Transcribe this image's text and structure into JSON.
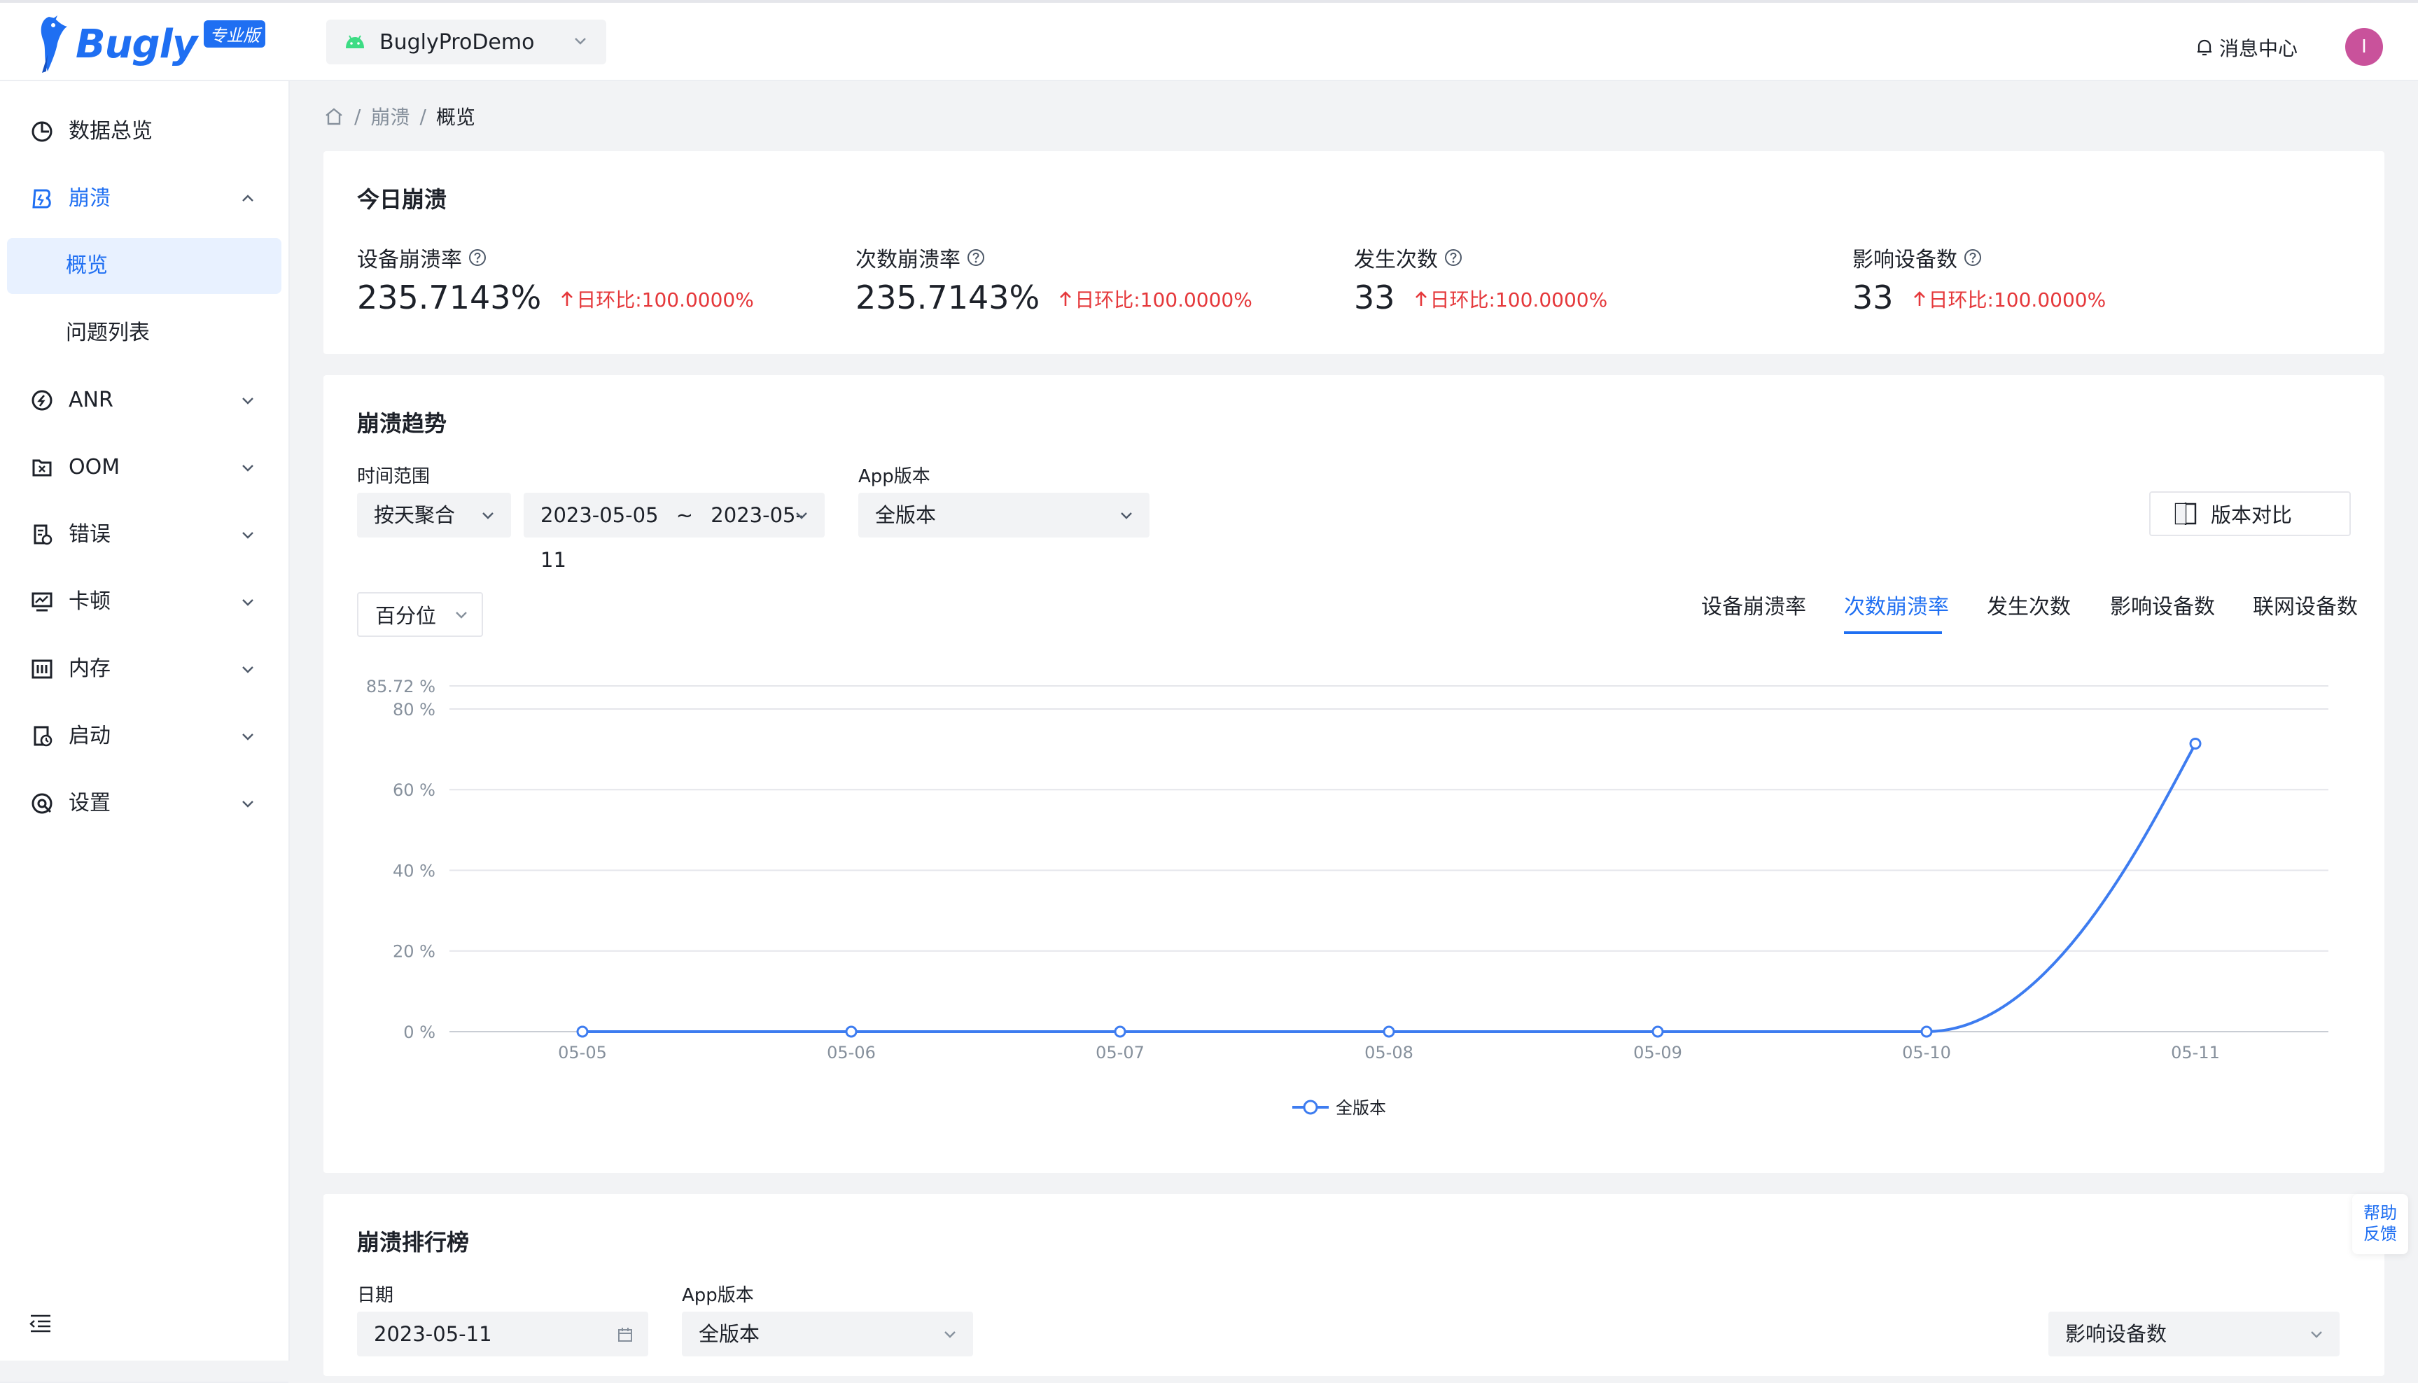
{
  "header": {
    "logo_text": "Bugly",
    "logo_badge": "专业版",
    "app_name": "BuglyProDemo",
    "messages_label": "消息中心",
    "avatar_initial": "I",
    "accent_color": "#1f6ff2"
  },
  "sidebar": {
    "items": [
      {
        "label": "数据总览",
        "icon": "pie-chart-icon"
      },
      {
        "label": "崩溃",
        "icon": "crash-icon"
      },
      {
        "label": "概览"
      },
      {
        "label": "问题列表"
      },
      {
        "label": "ANR",
        "icon": "anr-icon"
      },
      {
        "label": "OOM",
        "icon": "oom-icon"
      },
      {
        "label": "错误",
        "icon": "error-icon"
      },
      {
        "label": "卡顿",
        "icon": "lag-icon"
      },
      {
        "label": "内存",
        "icon": "memory-icon"
      },
      {
        "label": "启动",
        "icon": "launch-icon"
      },
      {
        "label": "设置",
        "icon": "settings-icon"
      }
    ]
  },
  "breadcrumb": {
    "sep": "/",
    "level1": "崩溃",
    "current": "概览"
  },
  "today": {
    "title": "今日崩溃",
    "metrics": [
      {
        "label": "设备崩溃率",
        "value": "235.7143%",
        "change": "日环比:100.0000%"
      },
      {
        "label": "次数崩溃率",
        "value": "235.7143%",
        "change": "日环比:100.0000%"
      },
      {
        "label": "发生次数",
        "value": "33",
        "change": "日环比:100.0000%"
      },
      {
        "label": "影响设备数",
        "value": "33",
        "change": "日环比:100.0000%"
      }
    ],
    "change_color": "#e5383b"
  },
  "trend": {
    "title": "崩溃趋势",
    "time_range_label": "时间范围",
    "aggregate": "按天聚合",
    "date_start": "2023-05-05",
    "date_sep": "~",
    "date_end": "2023-05-11",
    "version_label": "App版本",
    "version": "全版本",
    "compare_button": "版本对比",
    "percentile": "百分位",
    "tabs": [
      "设备崩溃率",
      "次数崩溃率",
      "发生次数",
      "影响设备数",
      "联网设备数"
    ],
    "active_tab": 1
  },
  "chart_data": {
    "type": "line",
    "categories": [
      "05-05",
      "05-06",
      "05-07",
      "05-08",
      "05-09",
      "05-10",
      "05-11"
    ],
    "series": [
      {
        "name": "全版本",
        "values": [
          0,
          0,
          0,
          0,
          0,
          0,
          71.4
        ]
      }
    ],
    "y_ticks": [
      "0 %",
      "20 %",
      "40 %",
      "60 %",
      "80 %",
      "85.72 %"
    ],
    "y_tick_values": [
      0,
      20,
      40,
      60,
      80,
      85.72
    ],
    "ylim": [
      0,
      85.72
    ],
    "grid": true,
    "legend": "bottom",
    "line_color": "#3d7cf0"
  },
  "ranking": {
    "title": "崩溃排行榜",
    "date_label": "日期",
    "date": "2023-05-11",
    "version_label": "App版本",
    "version": "全版本",
    "sort": "影响设备数"
  },
  "help": {
    "line1": "帮助",
    "line2": "反馈"
  }
}
